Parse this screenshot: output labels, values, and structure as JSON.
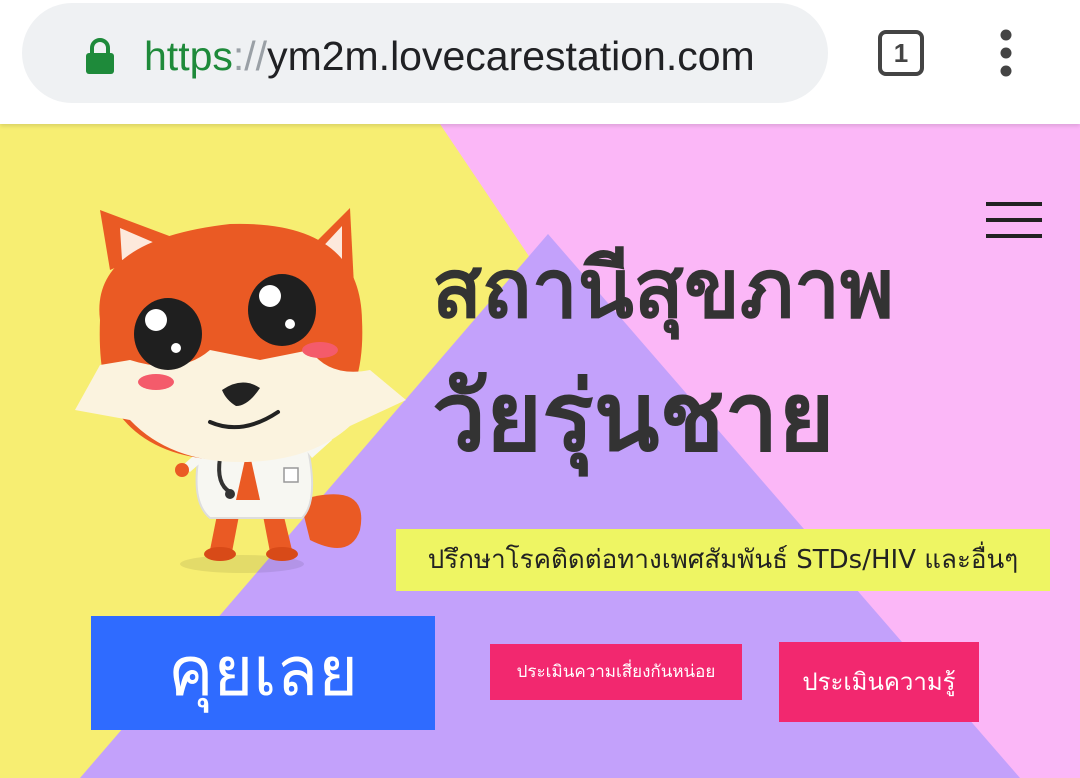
{
  "browser": {
    "url_scheme": "https",
    "url_separator": "://",
    "url_host": "ym2m.lovecarestation.com",
    "tab_count": "1",
    "icons": {
      "lock": "lock-icon",
      "tabs": "tab-switcher-icon",
      "menu": "more-vert-icon"
    },
    "colors": {
      "secure": "#1e8a3a"
    }
  },
  "page": {
    "title_line1": "สถานีสุขภาพ",
    "title_line2": "วัยรุ่นชาย",
    "tagline": "ปรึกษาโรคติดต่อทางเพศสัมพันธ์ STDs/HIV และอื่นๆ",
    "chat_button": "คุยเลย",
    "risk_button": "ประเมินความเสี่ยงกันหน่อย",
    "knowledge_button": "ประเมินความรู้",
    "icons": {
      "menu": "hamburger-icon",
      "mascot": "fox-doctor-mascot"
    },
    "colors": {
      "bg_yellow": "#f7ee72",
      "bg_pink": "#fbb7f7",
      "bg_purple": "#c3a1fb",
      "tagline_bg": "#eef563",
      "chat_button": "#2f6bff",
      "pink_buttons": "#f2286f"
    }
  }
}
